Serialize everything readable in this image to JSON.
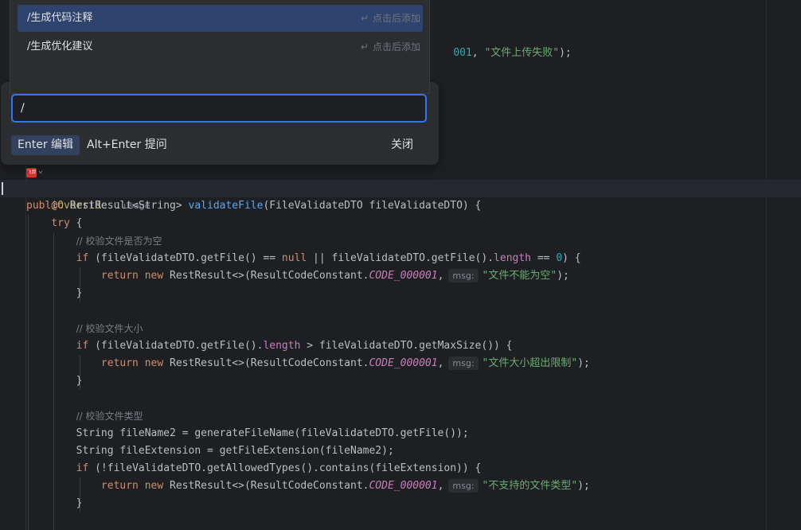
{
  "dropdown": {
    "items": [
      {
        "label": "/生成代码注释",
        "hint": "点击后添加"
      },
      {
        "label": "/生成优化建议",
        "hint": "点击后添加"
      }
    ]
  },
  "popup": {
    "input_value": "/",
    "enter_label": "Enter 编辑",
    "alt_enter_label": "Alt+Enter 提问",
    "close_label": "关闭"
  },
  "editor": {
    "partial_top_line": {
      "num": "001",
      "comma": ", ",
      "str": "\"文件上传失败\"",
      "tail": ");"
    },
    "vendor_icon_text": "飞算",
    "usage_hint": "1 usage",
    "annotation": "@Override",
    "param_hint": "msg:",
    "constant": "CODE_000001",
    "comments": {
      "empty": "// 校验文件是否为空",
      "size": "// 校验文件大小",
      "type": "// 校验文件类型"
    },
    "strings": {
      "empty": "\"文件不能为空\"",
      "size": "\"文件大小超出限制\"",
      "type": "\"不支持的文件类型\""
    }
  }
}
